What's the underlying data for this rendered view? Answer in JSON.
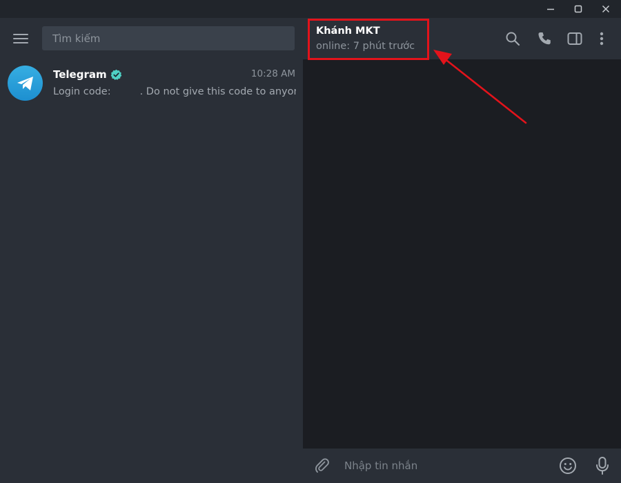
{
  "window": {
    "controls": [
      "minimize-icon",
      "maximize-icon",
      "close-icon"
    ]
  },
  "sidebar": {
    "menu_icon": "hamburger-menu-icon",
    "search": {
      "placeholder": "Tìm kiếm",
      "value": ""
    },
    "chats": [
      {
        "name": "Telegram",
        "verified": true,
        "time": "10:28 AM",
        "preview_prefix": "Login code:",
        "preview_suffix": ". Do not give this code to anyon...",
        "avatar_icon": "telegram-logo-icon"
      }
    ]
  },
  "chat": {
    "peer_name": "Khánh MKT",
    "peer_status": "online: 7 phút trước",
    "header_icons": [
      "search-icon",
      "phone-icon",
      "sidebar-panel-icon",
      "more-vertical-icon"
    ],
    "composer": {
      "placeholder": "Nhập tin nhắn",
      "value": "",
      "icons": [
        "attach-icon",
        "emoji-icon",
        "microphone-icon"
      ]
    }
  },
  "colors": {
    "accent": "#36aee2",
    "verified_badge": "#4fd1c5",
    "annotation": "#e3131b",
    "sidebar_bg": "#2a2f37",
    "chat_bg": "#1b1d22"
  }
}
